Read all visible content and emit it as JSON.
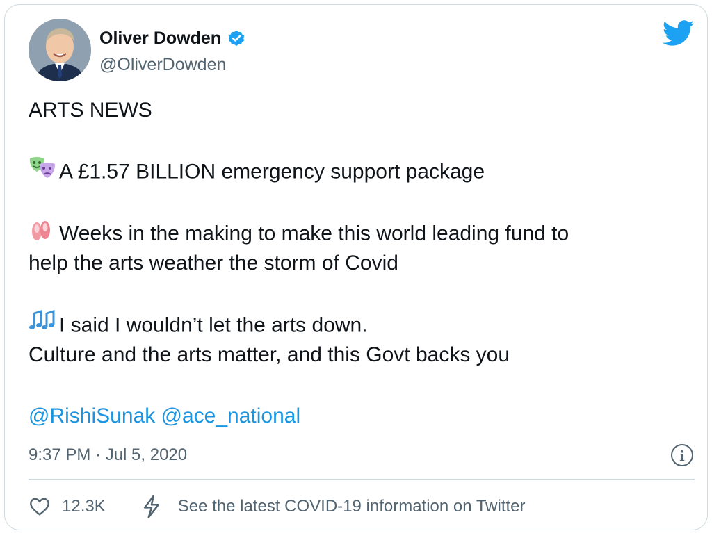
{
  "author": {
    "name": "Oliver Dowden",
    "handle": "@OliverDowden",
    "verified": true
  },
  "tweet": {
    "headline": "ARTS NEWS",
    "line1": "A £1.57 BILLION emergency support package",
    "line2a": "Weeks in the making to make this world leading fund to",
    "line2b": "help the arts weather the storm of Covid",
    "line3a": "I said I wouldn’t let the arts down.",
    "line3b": "Culture and the arts matter, and this Govt backs you",
    "mention1": "@RishiSunak",
    "mention2": "@ace_national",
    "emojis": [
      "performing-arts-icon",
      "ballet-shoes-icon",
      "musical-notes-icon"
    ]
  },
  "meta": {
    "timestamp": "9:37 PM · Jul 5, 2020",
    "info_glyph": "i"
  },
  "actions": {
    "likes": "12.3K",
    "covid_link": "See the latest COVID-19 information on Twitter"
  },
  "colors": {
    "accent": "#1b95e0",
    "twitter_blue": "#1da1f2",
    "secondary_text": "#536471",
    "border": "#cfd9de"
  }
}
